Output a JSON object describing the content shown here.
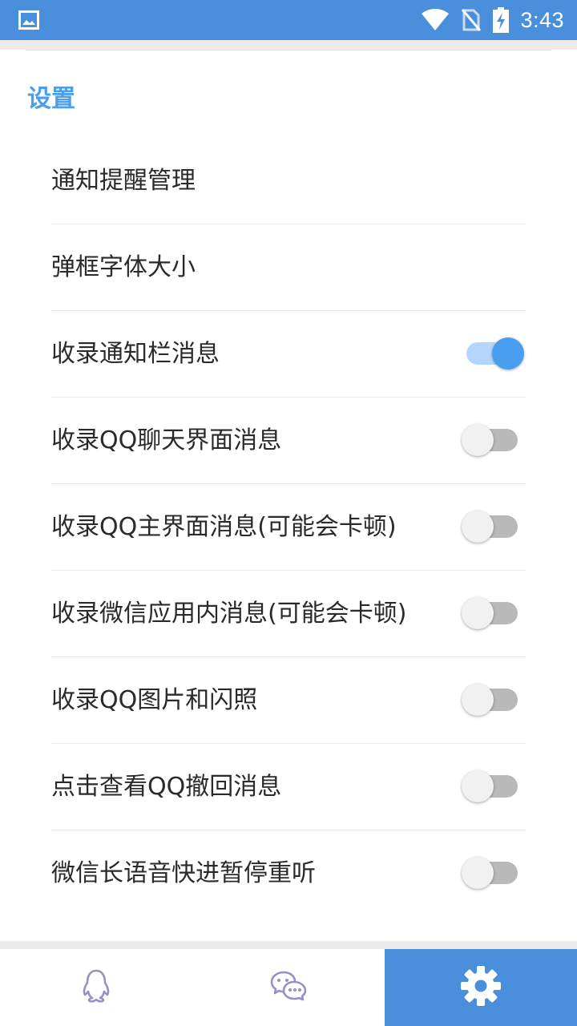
{
  "status_bar": {
    "time": "3:43",
    "icons": [
      "image-icon",
      "wifi-icon",
      "no-sim-icon",
      "battery-charging-icon"
    ]
  },
  "settings": {
    "section_title": "设置",
    "items": [
      {
        "label": "通知提醒管理"
      },
      {
        "label": "弹框字体大小"
      },
      {
        "label": "收录通知栏消息",
        "toggle": true
      },
      {
        "label": "收录QQ聊天界面消息",
        "toggle": false
      },
      {
        "label": "收录QQ主界面消息(可能会卡顿)",
        "toggle": false
      },
      {
        "label": "收录微信应用内消息(可能会卡顿)",
        "toggle": false
      },
      {
        "label": "收录QQ图片和闪照",
        "toggle": false
      },
      {
        "label": "点击查看QQ撤回消息",
        "toggle": false
      },
      {
        "label": "微信长语音快进暂停重听",
        "toggle": false
      }
    ]
  },
  "bottom_nav": {
    "tabs": [
      {
        "icon": "qq-penguin-icon",
        "active": false
      },
      {
        "icon": "wechat-icon",
        "active": false
      },
      {
        "icon": "gear-icon",
        "active": true
      }
    ]
  },
  "colors": {
    "accent": "#4a8fdb",
    "title": "#4a9ef0",
    "switch_on": "#4a9ef0",
    "switch_off_track": "#b9b9b9"
  }
}
